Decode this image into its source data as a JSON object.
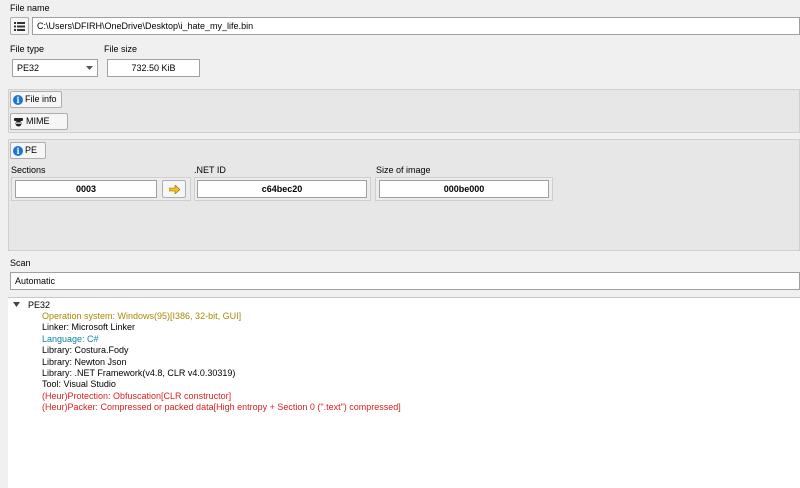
{
  "file_name": {
    "label": "File name",
    "path": "C:\\Users\\DFIRH\\OneDrive\\Desktop\\i_hate_my_life.bin"
  },
  "file_type": {
    "label": "File type",
    "value": "PE32"
  },
  "file_size": {
    "label": "File size",
    "value": "732.50 KiB"
  },
  "buttons": {
    "file_info": "File info",
    "mime": "MIME",
    "pe": "PE"
  },
  "pe": {
    "sections_label": "Sections",
    "sections_value": "0003",
    "net_id_label": ".NET ID",
    "net_id_value": "c64bec20",
    "size_of_image_label": "Size of image",
    "size_of_image_value": "000be000"
  },
  "scan": {
    "label": "Scan",
    "mode": "Automatic"
  },
  "results": {
    "root": "PE32",
    "lines": [
      {
        "text": "Operation system: Windows(95)[I386, 32-bit, GUI]",
        "color": "#a88a00"
      },
      {
        "text": "Linker: Microsoft Linker",
        "color": "#000000"
      },
      {
        "text": "Language: C#",
        "color": "#0a83a8"
      },
      {
        "text": "Library: Costura.Fody",
        "color": "#000000"
      },
      {
        "text": "Library: Newton Json",
        "color": "#000000"
      },
      {
        "text": "Library: .NET Framework(v4.8, CLR v4.0.30319)",
        "color": "#000000"
      },
      {
        "text": "Tool: Visual Studio",
        "color": "#000000"
      },
      {
        "text": "(Heur)Protection: Obfuscation[CLR constructor]",
        "color": "#e02020"
      },
      {
        "text": "(Heur)Packer: Compressed or packed data[High entropy + Section 0 (\".text\") compressed]",
        "color": "#e02020"
      }
    ]
  }
}
